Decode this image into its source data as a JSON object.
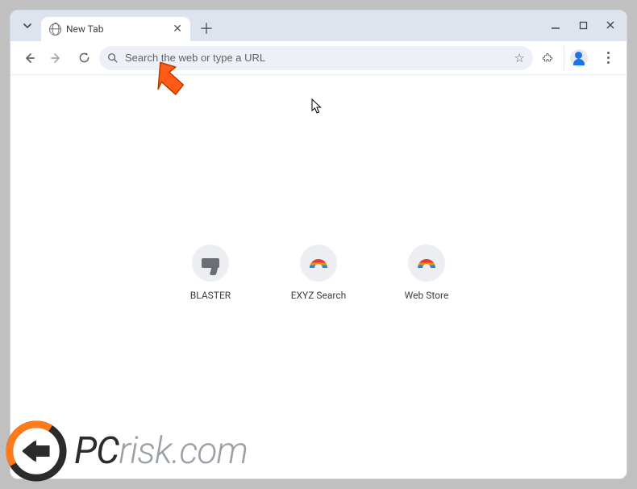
{
  "tab": {
    "title": "New Tab"
  },
  "omnibox": {
    "placeholder": "Search the web or type a URL",
    "value": ""
  },
  "shortcuts": [
    {
      "label": "BLASTER",
      "icon": "gun-icon"
    },
    {
      "label": "EXYZ Search",
      "icon": "rainbow-icon"
    },
    {
      "label": "Web Store",
      "icon": "rainbow-icon"
    }
  ],
  "watermark": {
    "text_prefix": "PC",
    "text_suffix": "risk.com"
  }
}
